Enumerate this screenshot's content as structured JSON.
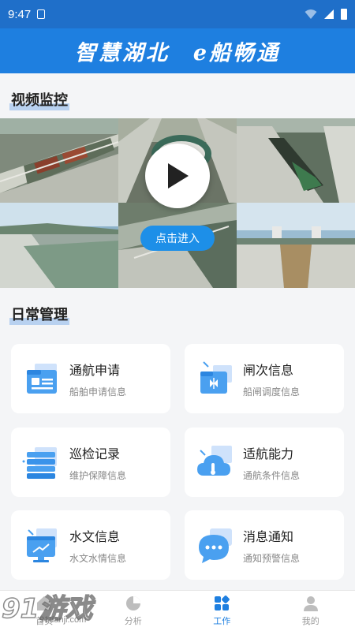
{
  "status_bar": {
    "time": "9:47"
  },
  "banner": {
    "text_left": "智慧湖北",
    "text_right": "e船畅通"
  },
  "video_section": {
    "title": "视频监控",
    "enter_label": "点击进入"
  },
  "daily_section": {
    "title": "日常管理",
    "cards": [
      {
        "title": "通航申请",
        "subtitle": "船舶申请信息",
        "icon": "ship-application-icon"
      },
      {
        "title": "闸次信息",
        "subtitle": "船闸调度信息",
        "icon": "lock-schedule-icon"
      },
      {
        "title": "巡检记录",
        "subtitle": "维护保障信息",
        "icon": "inspection-record-icon"
      },
      {
        "title": "适航能力",
        "subtitle": "通航条件信息",
        "icon": "navigability-icon"
      },
      {
        "title": "水文信息",
        "subtitle": "水文水情信息",
        "icon": "hydrology-icon"
      },
      {
        "title": "消息通知",
        "subtitle": "通知预警信息",
        "icon": "message-notification-icon"
      }
    ]
  },
  "bottom_nav": {
    "items": [
      {
        "label": "首页",
        "icon": "home-icon"
      },
      {
        "label": "分析",
        "icon": "pie-chart-icon"
      },
      {
        "label": "工作",
        "icon": "work-grid-icon",
        "active": true
      },
      {
        "label": "我的",
        "icon": "profile-icon"
      }
    ]
  },
  "watermark": {
    "big": "91游戏",
    "small": "91danji.com"
  },
  "colors": {
    "primary": "#1e7fe0",
    "status_bar": "#1f6fc9",
    "background": "#f4f5f7"
  }
}
